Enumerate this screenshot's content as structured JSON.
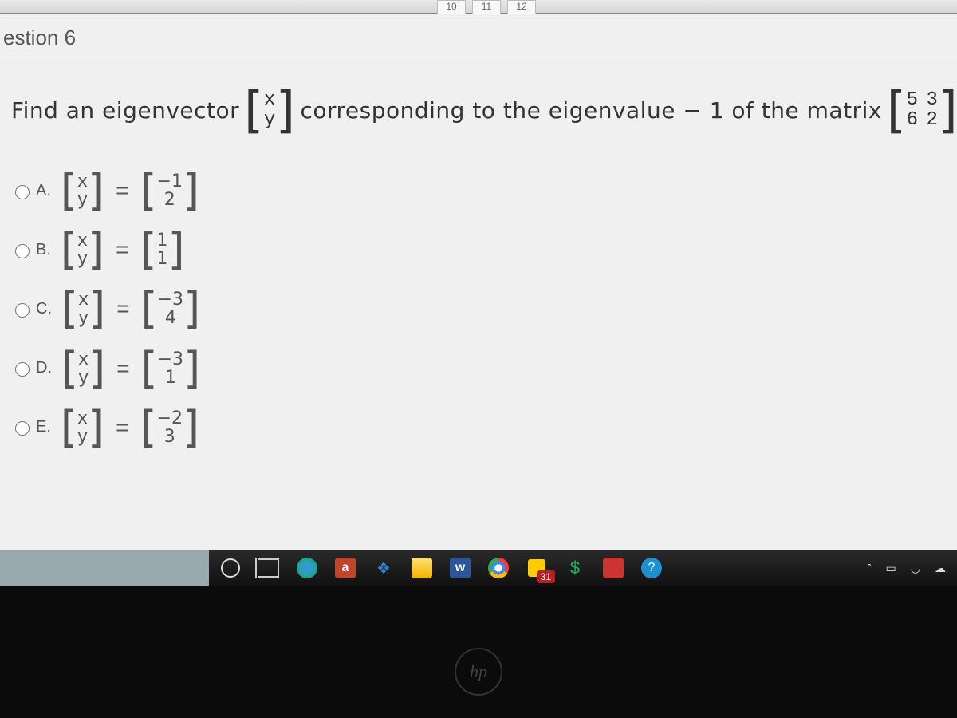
{
  "nav": {
    "a": "10",
    "b": "11",
    "c": "12"
  },
  "header": {
    "title": "estion 6"
  },
  "prompt": {
    "p1": "Find an eigenvector",
    "vector_top": "x",
    "vector_bot": "y",
    "p2": "corresponding to the eigenvalue − 1 of the matrix",
    "mat_r1c1": "5",
    "mat_r1c2": "3",
    "mat_r2c1": "6",
    "mat_r2c2": "2"
  },
  "choice_labels": {
    "A": "A.",
    "B": "B.",
    "C": "C.",
    "D": "D.",
    "E": "E."
  },
  "lhs": {
    "top": "x",
    "bot": "y"
  },
  "eq": "=",
  "choices": {
    "A": {
      "top": "−1",
      "bot": "2"
    },
    "B": {
      "top": "1",
      "bot": "1"
    },
    "C": {
      "top": "−3",
      "bot": "4"
    },
    "D": {
      "top": "−3",
      "bot": "1"
    },
    "E": {
      "top": "−2",
      "bot": "3"
    }
  },
  "taskbar": {
    "a_label": "a",
    "w_label": "w",
    "badge": "31",
    "caret": "ˆ",
    "dollar": "$"
  }
}
